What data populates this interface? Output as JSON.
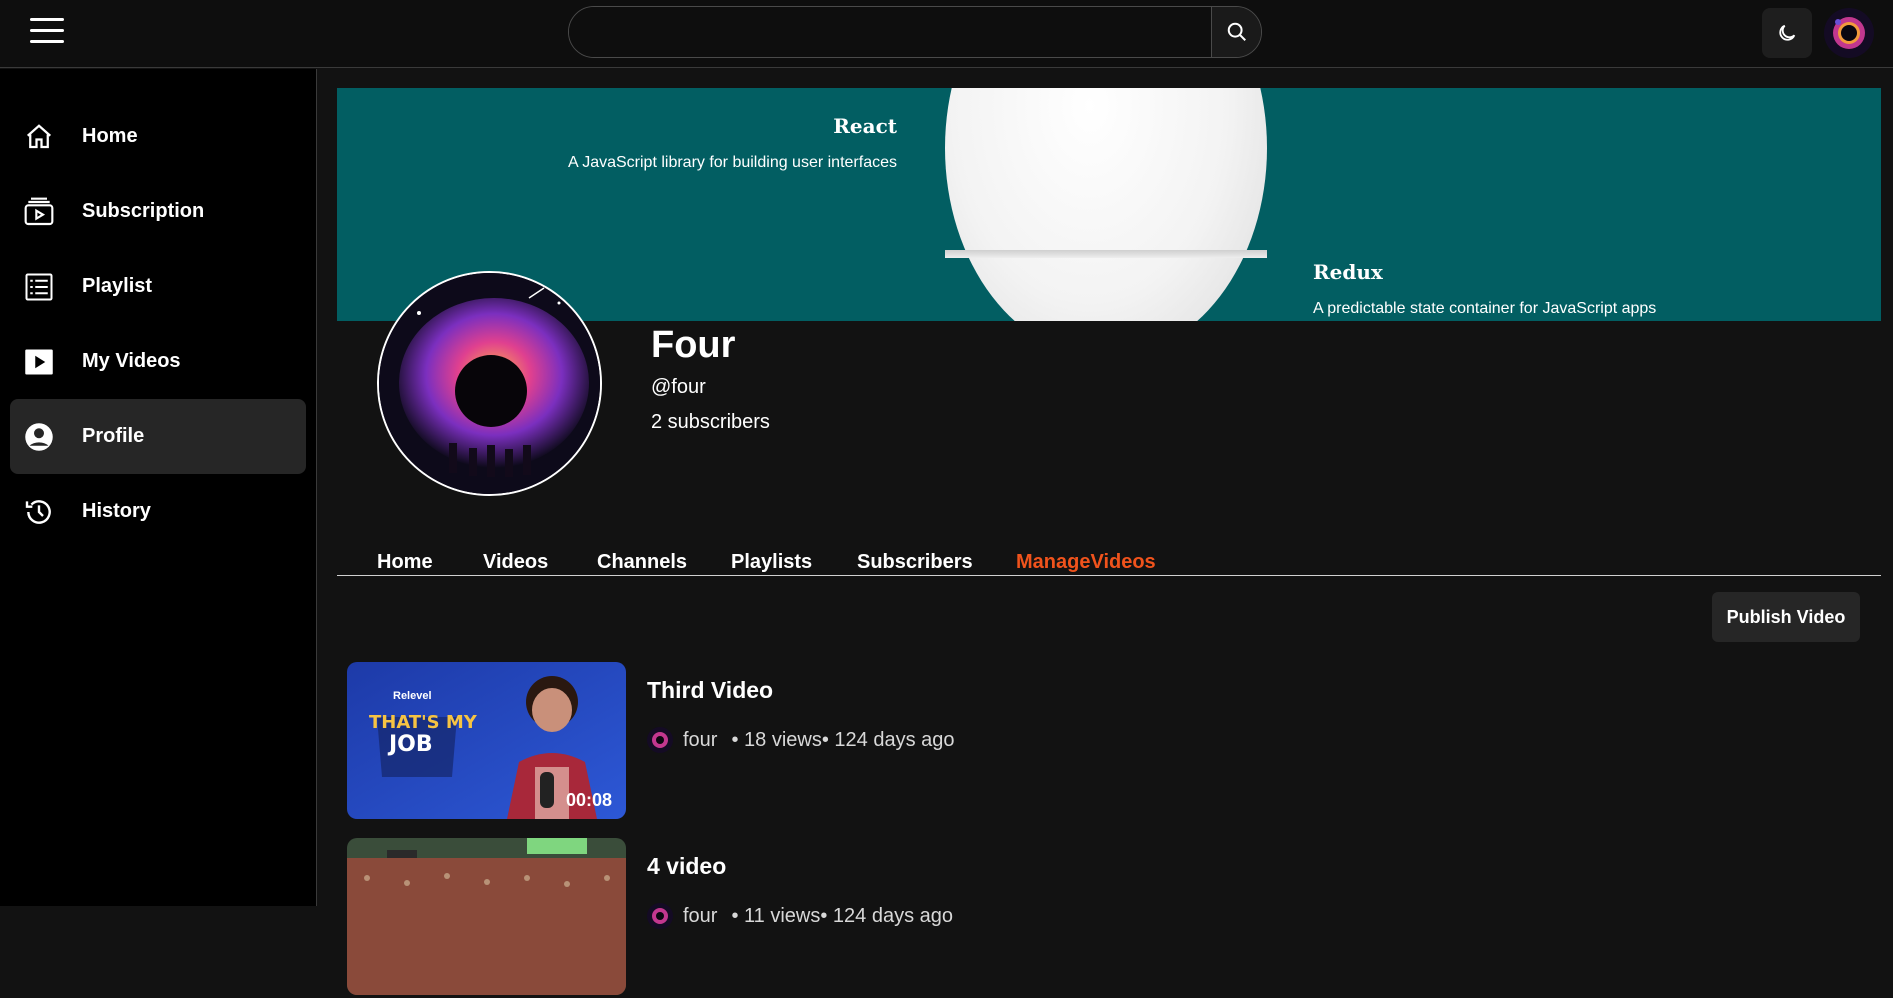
{
  "search": {
    "placeholder": ""
  },
  "sidebar": {
    "items": [
      {
        "label": "Home",
        "icon": "home-icon"
      },
      {
        "label": "Subscription",
        "icon": "subscription-icon"
      },
      {
        "label": "Playlist",
        "icon": "playlist-icon"
      },
      {
        "label": "My Videos",
        "icon": "play-icon"
      },
      {
        "label": "Profile",
        "icon": "user-circle-icon",
        "active": true
      },
      {
        "label": "History",
        "icon": "history-icon"
      }
    ]
  },
  "banner": {
    "react_title": "React",
    "react_subtitle": "A JavaScript library for building user interfaces",
    "redux_title": "Redux",
    "redux_subtitle": "A predictable state container for JavaScript apps",
    "background": "#025e62"
  },
  "profile": {
    "name": "Four",
    "handle": "@four",
    "subscribers": "2 subscribers"
  },
  "tabs": [
    {
      "label": "Home"
    },
    {
      "label": "Videos"
    },
    {
      "label": "Channels"
    },
    {
      "label": "Playlists"
    },
    {
      "label": "Subscribers"
    },
    {
      "label": "ManageVideos",
      "active": true
    }
  ],
  "accent_color": "#f0531c",
  "publish_label": "Publish Video",
  "videos": [
    {
      "title": "Third Video",
      "channel": "four",
      "stats": "• 18 views• 124 days ago",
      "duration": "00:08",
      "thumb_text_1": "Relevel",
      "thumb_text_2": "THAT'S MY",
      "thumb_text_3": "JOB"
    },
    {
      "title": "4 video",
      "channel": "four",
      "stats": "• 11 views• 124 days ago",
      "duration": ""
    }
  ]
}
